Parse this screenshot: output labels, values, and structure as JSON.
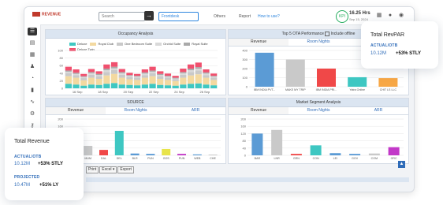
{
  "header": {
    "logo_text": "REVENUE",
    "search_placeholder": "Search",
    "search_go": "→",
    "module": "Frontdesk",
    "nav": [
      "Others",
      "Report",
      "How to use?"
    ],
    "kpi_label": "KPI",
    "hours": "16.25 Hrs",
    "date": "Sep 15, 2024"
  },
  "sidebar": {
    "icons": [
      "menu-icon",
      "document-icon",
      "calendar-icon",
      "users-icon",
      "pie-chart-icon",
      "bar-chart-icon",
      "line-chart-icon",
      "settings-icon",
      "key-icon",
      "share-icon"
    ]
  },
  "occupancy": {
    "title": "Occupancy Analysis",
    "legend": [
      {
        "name": "Deluxe",
        "color": "#3ec7c2"
      },
      {
        "name": "Royal Club",
        "color": "#f3d9a0"
      },
      {
        "name": "One Bedroom Suite",
        "color": "#c9c9c9"
      },
      {
        "name": "Orchid Suite",
        "color": "#d9d9d9"
      },
      {
        "name": "Royal Suite",
        "color": "#a9a9a9"
      },
      {
        "name": "Deluxe Twin",
        "color": "#f0506e"
      }
    ]
  },
  "ota": {
    "title": "Top 5 OTA Performance",
    "include_offline": "Include offline",
    "tabs": [
      "Revenue",
      "Room Nights",
      "ARR"
    ]
  },
  "source": {
    "title": "SOURCE",
    "tabs": [
      "Revenue",
      "Room Nights",
      "ARR"
    ]
  },
  "market": {
    "title": "Market Segment Analysis",
    "tabs": [
      "Revenue",
      "Room Nights",
      "ARR"
    ]
  },
  "buttons": {
    "print": "Print",
    "excel": "Excel ▾",
    "export": "Export"
  },
  "scroll_up": "▲",
  "card_revpar": {
    "title": "Total RevPAR",
    "label": "ACTUAL/OTB",
    "value": "10.12M",
    "change": "+53% STLY"
  },
  "card_revenue": {
    "title": "Total Revenue",
    "label1": "ACTUAL/OTB",
    "value1": "10.12M",
    "change1": "+53% STLY",
    "label2": "PROJECTED",
    "value2": "10.47M",
    "change2": "+51% LY"
  },
  "chart_data": [
    {
      "type": "bar",
      "title": "Occupancy Analysis",
      "stacked": true,
      "categories": [
        "16 Sep",
        "18 Sep",
        "20 Sep",
        "22 Sep",
        "24 Sep",
        "26 Sep"
      ],
      "ylim": [
        0,
        100
      ],
      "yticks": [
        0,
        20,
        40,
        60,
        80,
        100
      ],
      "series": [
        {
          "name": "Deluxe",
          "color": "#3ec7c2",
          "values": [
            12,
            10,
            7,
            10,
            9,
            12,
            14,
            10,
            9,
            8,
            10,
            12,
            9,
            8,
            7,
            10,
            12,
            13,
            10,
            8
          ]
        },
        {
          "name": "Royal Club",
          "color": "#f3d9a0",
          "values": [
            20,
            18,
            14,
            18,
            16,
            22,
            24,
            18,
            15,
            14,
            18,
            20,
            16,
            14,
            12,
            18,
            22,
            24,
            18,
            14
          ]
        },
        {
          "name": "One Bedroom Suite",
          "color": "#c9c9c9",
          "values": [
            8,
            7,
            6,
            8,
            7,
            9,
            10,
            8,
            6,
            6,
            7,
            8,
            7,
            6,
            5,
            8,
            9,
            10,
            7,
            6
          ]
        },
        {
          "name": "Orchid Suite",
          "color": "#d9d9d9",
          "values": [
            4,
            3,
            3,
            4,
            3,
            5,
            5,
            4,
            3,
            3,
            4,
            4,
            3,
            3,
            2,
            4,
            5,
            5,
            4,
            3
          ]
        },
        {
          "name": "Royal Suite",
          "color": "#a9a9a9",
          "values": [
            3,
            3,
            2,
            3,
            3,
            4,
            4,
            3,
            2,
            2,
            3,
            3,
            3,
            2,
            2,
            3,
            4,
            4,
            3,
            2
          ]
        },
        {
          "name": "Deluxe Twin",
          "color": "#f0506e",
          "values": [
            10,
            9,
            6,
            8,
            7,
            11,
            12,
            8,
            6,
            5,
            8,
            10,
            7,
            6,
            5,
            9,
            11,
            12,
            8,
            6
          ]
        }
      ]
    },
    {
      "type": "bar",
      "title": "Top 5 OTA Performance",
      "categories": [
        "IBM INDIA PVT...",
        "MAKE MY TRIP",
        "IBM INDIA PRI...",
        "Yatra Online",
        "CHIT LS LLC"
      ],
      "ylim": [
        0,
        400
      ],
      "yticks": [
        0,
        100,
        200,
        300,
        400
      ],
      "values": [
        375,
        300,
        200,
        105,
        95
      ],
      "colors": [
        "#5b9bd5",
        "#c9c9c9",
        "#f04848",
        "#3ec7c2",
        "#f7a745"
      ]
    },
    {
      "type": "bar",
      "title": "SOURCE",
      "categories": [
        "CTA",
        "MUM",
        "DAL",
        "DEL",
        "BLR",
        "PUN",
        "GOS",
        "PUN",
        "WEB",
        "CHE"
      ],
      "ylim": [
        0,
        200
      ],
      "yticks": [
        0,
        40,
        80,
        120,
        160,
        200
      ],
      "values": [
        60,
        52,
        30,
        135,
        10,
        8,
        35,
        8,
        5,
        4
      ],
      "colors": [
        "#3ec7c2",
        "#c9c9c9",
        "#f04848",
        "#3ec7c2",
        "#5b9bd5",
        "#5b9bd5",
        "#e8e44a",
        "#c238c8",
        "#5b9bd5",
        "#c9c9c9"
      ]
    },
    {
      "type": "bar",
      "title": "Market Segment Analysis",
      "categories": [
        "BAR",
        "LNR",
        "GRN",
        "CON",
        "LEI",
        "GOV",
        "COM",
        "GRC"
      ],
      "ylim": [
        0,
        200
      ],
      "yticks": [
        0,
        40,
        80,
        120,
        160,
        200
      ],
      "values": [
        120,
        140,
        8,
        55,
        12,
        8,
        10,
        45
      ],
      "colors": [
        "#5b9bd5",
        "#c9c9c9",
        "#f04848",
        "#3ec7c2",
        "#5b9bd5",
        "#5b9bd5",
        "#c9c9c9",
        "#c238c8"
      ]
    }
  ]
}
